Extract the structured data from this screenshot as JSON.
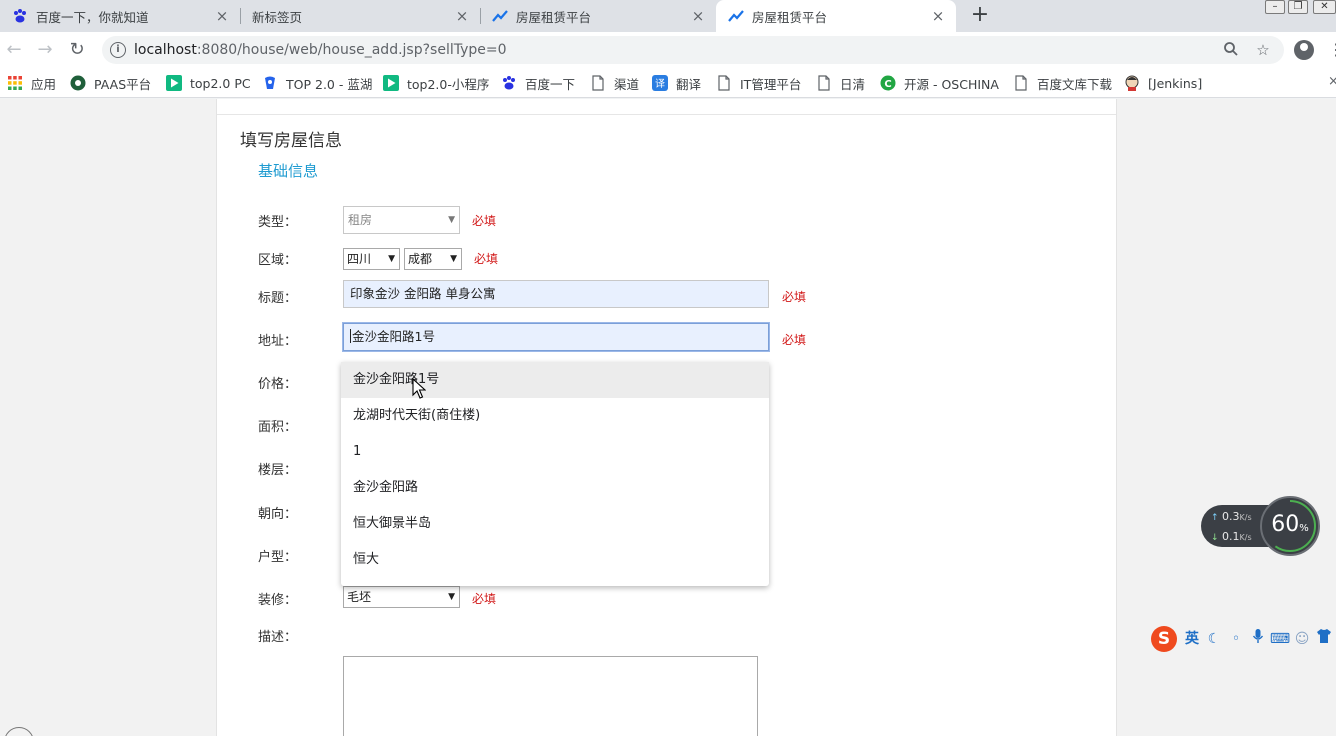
{
  "browser": {
    "tabs": [
      {
        "title": "百度一下，你就知道",
        "icon": "baidu-paw-icon",
        "active": false
      },
      {
        "title": "新标签页",
        "icon": "",
        "active": false
      },
      {
        "title": "房屋租赁平台",
        "icon": "trend-chart-icon",
        "active": false
      },
      {
        "title": "房屋租赁平台",
        "icon": "trend-chart-icon",
        "active": true
      }
    ],
    "new_tab_label": "+",
    "url_host": "localhost",
    "url_rest": ":8080/house/web/house_add.jsp?sellType=0",
    "bookmarks": [
      {
        "label": "应用",
        "icon": "apps-grid-icon"
      },
      {
        "label": "PAAS平台",
        "icon": "paas-logo-icon"
      },
      {
        "label": "top2.0 PC",
        "icon": "play-green-icon"
      },
      {
        "label": "TOP 2.0 - 蓝湖",
        "icon": "lanhu-logo-icon"
      },
      {
        "label": "top2.0-小程序",
        "icon": "play-green-icon"
      },
      {
        "label": "百度一下",
        "icon": "baidu-paw-icon"
      },
      {
        "label": "渠道",
        "icon": "page-icon"
      },
      {
        "label": "翻译",
        "icon": "translate-icon"
      },
      {
        "label": "IT管理平台",
        "icon": "page-icon"
      },
      {
        "label": "日清",
        "icon": "page-icon"
      },
      {
        "label": "开源 - OSCHINA",
        "icon": "oschina-logo-icon"
      },
      {
        "label": "百度文库下载",
        "icon": "page-icon"
      },
      {
        "label": "[Jenkins]",
        "icon": "jenkins-logo-icon"
      }
    ]
  },
  "form": {
    "page_title": "填写房屋信息",
    "section_title": "基础信息",
    "required_text": "必填",
    "labels": {
      "type": "类型：",
      "region": "区域：",
      "title": "标题：",
      "address": "地址：",
      "price": "价格：",
      "area": "面积：",
      "floor": "楼层：",
      "orientation": "朝向：",
      "layout": "户型：",
      "decoration": "装修：",
      "description": "描述："
    },
    "values": {
      "type": "租房",
      "province": "四川",
      "city": "成都",
      "title": "印象金沙 金阳路 单身公寓",
      "address": "金沙金阳路1号",
      "decoration": "毛坯"
    }
  },
  "autocomplete": {
    "items": [
      "金沙金阳路1号",
      "龙湖时代天街(商住楼)",
      "1",
      "金沙金阳路",
      "恒大御景半岛",
      "恒大"
    ]
  },
  "overlay": {
    "upload_speed": "0.3",
    "download_speed": "0.1",
    "speed_unit": "K/s",
    "gauge_value": "60",
    "gauge_unit": "%",
    "ime_mode": "英"
  }
}
